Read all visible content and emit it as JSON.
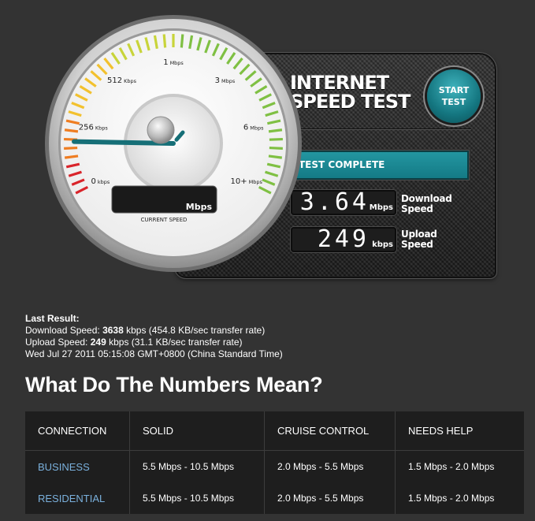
{
  "app": {
    "title_line1": "INTERNET",
    "title_line2": "SPEED TEST",
    "accent_color": "#1b8c96"
  },
  "start_button": {
    "line1": "START",
    "line2": "TEST"
  },
  "status": "TEST COMPLETE",
  "gauge": {
    "ticks": [
      {
        "value": "0",
        "unit": "kbps"
      },
      {
        "value": "256",
        "unit": "Kbps"
      },
      {
        "value": "512",
        "unit": "Kbps"
      },
      {
        "value": "1",
        "unit": "Mbps"
      },
      {
        "value": "3",
        "unit": "Mbps"
      },
      {
        "value": "6",
        "unit": "Mbps"
      },
      {
        "value": "10+",
        "unit": "Mbps"
      }
    ],
    "readout_unit": "Mbps",
    "caption": "CURRENT SPEED",
    "needle_level": 0.12
  },
  "download": {
    "value": "3.64",
    "unit": "Mbps",
    "label_line1": "Download",
    "label_line2": "Speed"
  },
  "upload": {
    "value": "249",
    "unit": "kbps",
    "label_line1": "Upload",
    "label_line2": "Speed"
  },
  "last_result": {
    "heading": "Last Result:",
    "download_prefix": "Download Speed: ",
    "download_value": "3638",
    "download_suffix": " kbps (454.8 KB/sec transfer rate)",
    "upload_prefix": "Upload Speed: ",
    "upload_value": "249",
    "upload_suffix": " kbps (31.1 KB/sec transfer rate)",
    "timestamp": "Wed Jul 27 2011 05:15:08 GMT+0800 (China Standard Time)"
  },
  "numbers_heading": "What Do The Numbers Mean?",
  "table": {
    "headers": [
      "CONNECTION",
      "SOLID",
      "CRUISE CONTROL",
      "NEEDS HELP"
    ],
    "rows": [
      [
        "BUSINESS",
        "5.5 Mbps - 10.5 Mbps",
        "2.0 Mbps - 5.5 Mbps",
        "1.5 Mbps - 2.0 Mbps"
      ],
      [
        "RESIDENTIAL",
        "5.5 Mbps - 10.5 Mbps",
        "2.0 Mbps - 5.5 Mbps",
        "1.5 Mbps - 2.0 Mbps"
      ]
    ]
  }
}
